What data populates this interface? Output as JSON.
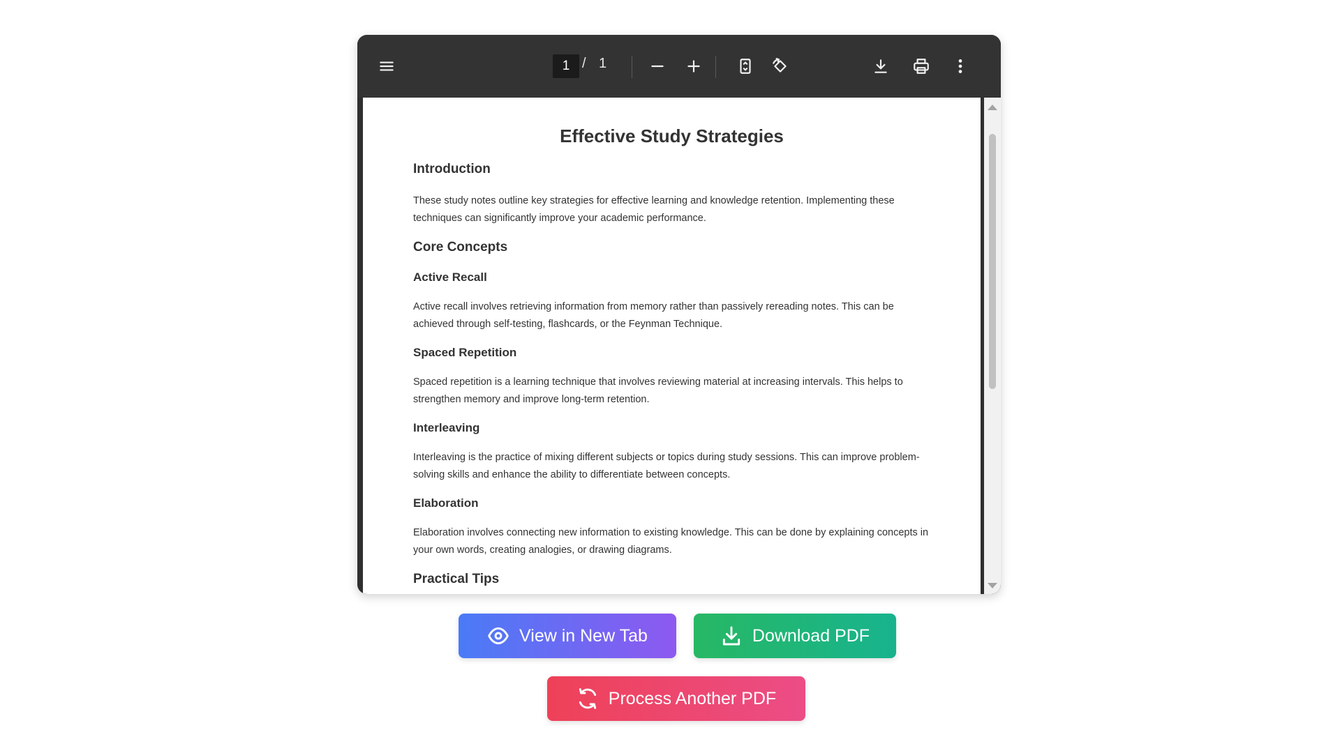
{
  "toolbar": {
    "menu_icon": "hamburger-menu-icon",
    "page_current": "1",
    "page_separator": "/",
    "page_total": "1",
    "zoom_out_icon": "minus-icon",
    "zoom_in_icon": "plus-icon",
    "fit_page_icon": "fit-page-icon",
    "rotate_icon": "rotate-icon",
    "download_icon": "download-icon",
    "print_icon": "print-icon",
    "more_icon": "more-vertical-icon"
  },
  "document": {
    "title": "Effective Study Strategies",
    "intro_heading": "Introduction",
    "intro_text": "These study notes outline key strategies for effective learning and knowledge retention. Implementing these techniques can significantly improve your academic performance.",
    "core_heading": "Core Concepts",
    "sections": [
      {
        "heading": "Active Recall",
        "text": "Active recall involves retrieving information from memory rather than passively rereading notes. This can be achieved through self-testing, flashcards, or the Feynman Technique."
      },
      {
        "heading": "Spaced Repetition",
        "text": "Spaced repetition is a learning technique that involves reviewing material at increasing intervals. This helps to strengthen memory and improve long-term retention."
      },
      {
        "heading": "Interleaving",
        "text": "Interleaving is the practice of mixing different subjects or topics during study sessions. This can improve problem-solving skills and enhance the ability to differentiate between concepts."
      },
      {
        "heading": "Elaboration",
        "text": "Elaboration involves connecting new information to existing knowledge. This can be done by explaining concepts in your own words, creating analogies, or drawing diagrams."
      }
    ],
    "practical_heading": "Practical Tips"
  },
  "actions": {
    "view_label": "View in New Tab",
    "view_icon": "eye-icon",
    "download_label": "Download PDF",
    "download_icon": "download-icon",
    "process_label": "Process Another PDF",
    "process_icon": "refresh-icon"
  },
  "colors": {
    "toolbar_bg": "#333333",
    "view_gradient": [
      "#4a7bf6",
      "#8e59f0"
    ],
    "download_gradient": [
      "#27b864",
      "#18b38e"
    ],
    "process_gradient": [
      "#ee4158",
      "#ec4d86"
    ]
  }
}
